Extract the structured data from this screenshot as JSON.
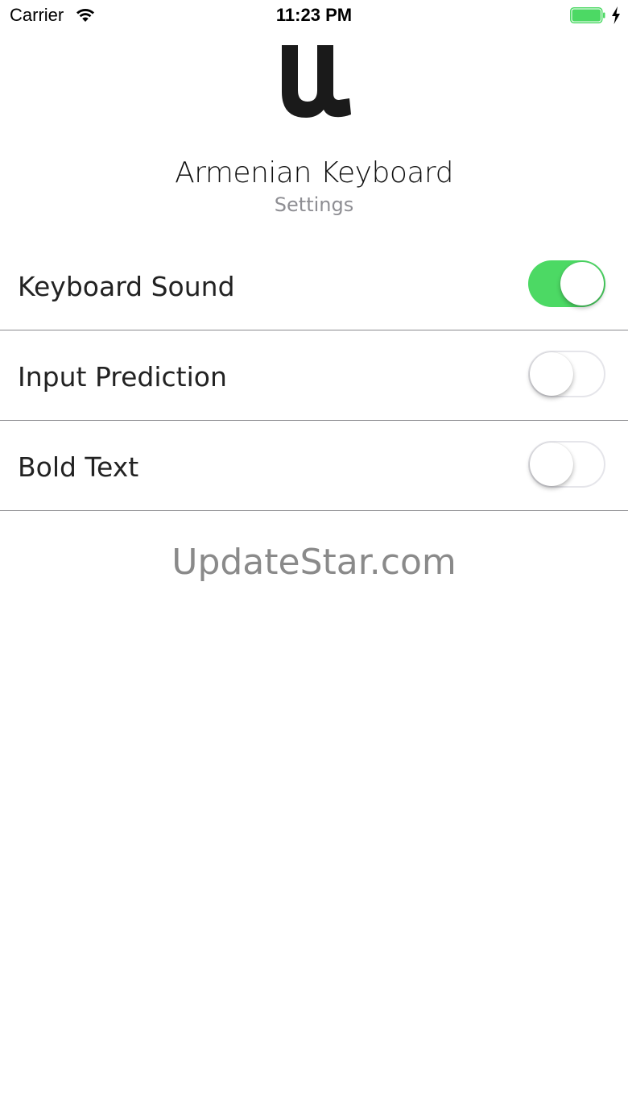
{
  "status_bar": {
    "carrier": "Carrier",
    "time": "11:23 PM",
    "battery_color": "#4cd964"
  },
  "header": {
    "logo_icon": "armenian-letter-u-logo",
    "title": "Armenian Keyboard",
    "subtitle": "Settings"
  },
  "settings": [
    {
      "label": "Keyboard Sound",
      "enabled": true
    },
    {
      "label": "Input Prediction",
      "enabled": false
    },
    {
      "label": "Bold Text",
      "enabled": false
    }
  ],
  "footer": {
    "brand": "UpdateStar.com"
  },
  "colors": {
    "toggle_on": "#4cd964",
    "toggle_off_border": "#e5e5ea",
    "subtitle": "#8e8e93"
  }
}
